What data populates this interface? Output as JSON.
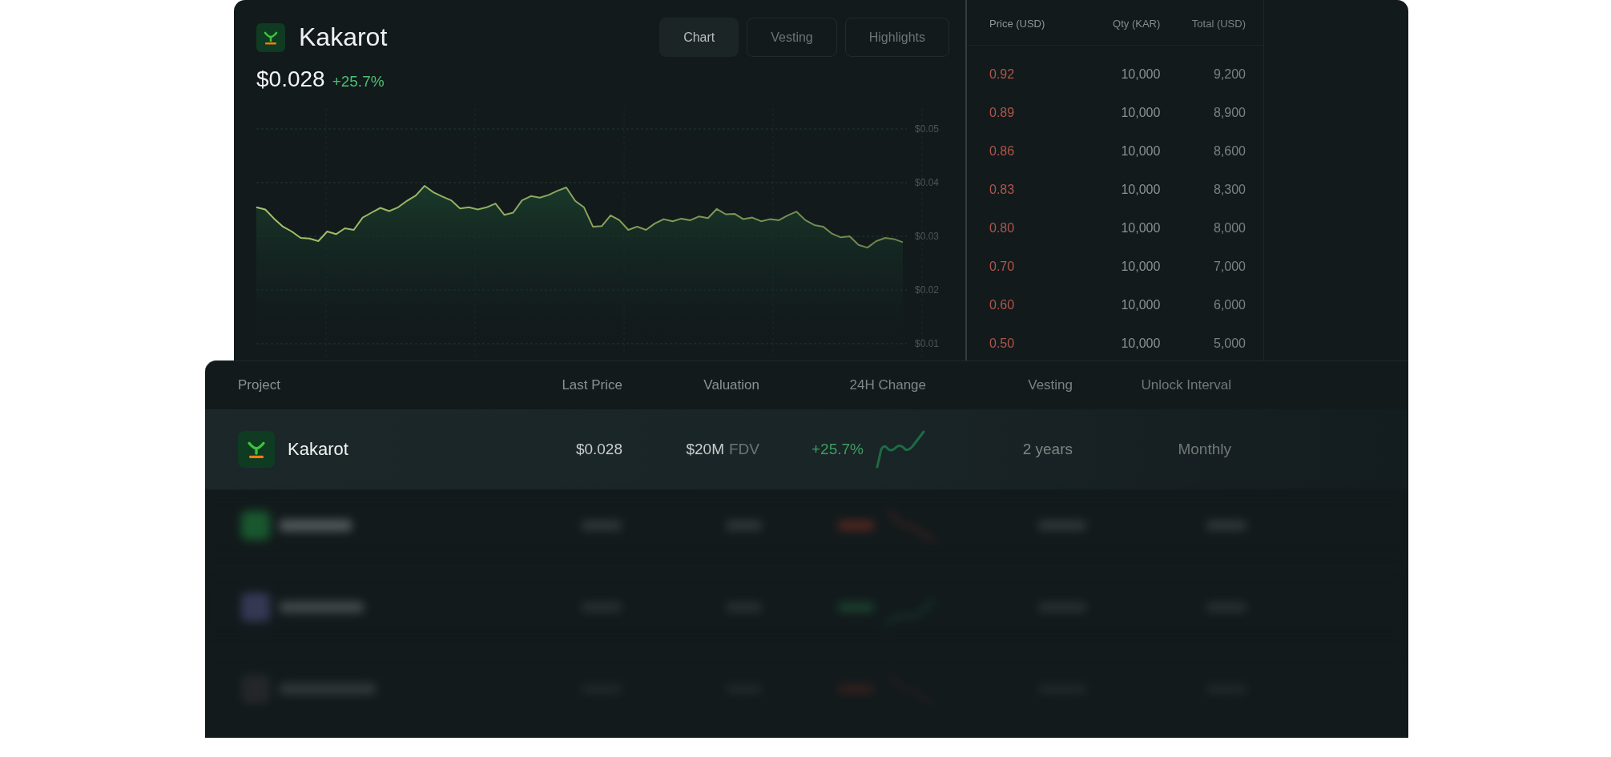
{
  "token": {
    "name": "Kakarot",
    "price": "$0.028",
    "change": "+25.7%"
  },
  "tabs": [
    {
      "label": "Chart",
      "selected": true
    },
    {
      "label": "Vesting",
      "selected": false
    },
    {
      "label": "Highlights",
      "selected": false
    }
  ],
  "chart_data": {
    "type": "area",
    "grid": true,
    "ylim": [
      0.01,
      0.05
    ],
    "yticks": [
      {
        "value": 0.05,
        "label": "$0.05"
      },
      {
        "value": 0.04,
        "label": "$0.04"
      },
      {
        "value": 0.03,
        "label": "$0.03"
      },
      {
        "value": 0.02,
        "label": "$0.02"
      },
      {
        "value": 0.01,
        "label": "$0.01"
      }
    ],
    "series": [
      {
        "color": "#a6c46a",
        "values": [
          0.0354,
          0.035,
          0.0333,
          0.0318,
          0.0309,
          0.0297,
          0.0296,
          0.0291,
          0.0309,
          0.0304,
          0.0315,
          0.0312,
          0.0335,
          0.0344,
          0.0353,
          0.0347,
          0.0354,
          0.0366,
          0.0376,
          0.0394,
          0.0382,
          0.0374,
          0.0367,
          0.0352,
          0.0354,
          0.035,
          0.0354,
          0.0361,
          0.034,
          0.0344,
          0.0367,
          0.0375,
          0.0372,
          0.0377,
          0.0385,
          0.0391,
          0.0366,
          0.0354,
          0.0318,
          0.0319,
          0.0339,
          0.033,
          0.0312,
          0.0318,
          0.0312,
          0.0324,
          0.0332,
          0.0328,
          0.0333,
          0.033,
          0.0337,
          0.0334,
          0.0351,
          0.0341,
          0.0342,
          0.0332,
          0.0335,
          0.0328,
          0.0332,
          0.033,
          0.0339,
          0.0346,
          0.033,
          0.0321,
          0.0318,
          0.0305,
          0.0298,
          0.03,
          0.0284,
          0.0279,
          0.0291,
          0.0297,
          0.0295,
          0.0289
        ]
      }
    ]
  },
  "order_book": {
    "columns": [
      "Price (USD)",
      "Qty (KAR)",
      "Total (USD)"
    ],
    "rows": [
      [
        "0.92",
        "10,000",
        "9,200"
      ],
      [
        "0.89",
        "10,000",
        "8,900"
      ],
      [
        "0.86",
        "10,000",
        "8,600"
      ],
      [
        "0.83",
        "10,000",
        "8,300"
      ],
      [
        "0.80",
        "10,000",
        "8,000"
      ],
      [
        "0.70",
        "10,000",
        "7,000"
      ],
      [
        "0.60",
        "10,000",
        "6,000"
      ],
      [
        "0.50",
        "10,000",
        "5,000"
      ]
    ]
  },
  "table": {
    "columns": [
      "Project",
      "Last Price",
      "Valuation",
      "24H Change",
      "Vesting",
      "Unlock Interval"
    ],
    "rows": [
      {
        "name": "Kakarot",
        "last_price": "$0.028",
        "valuation": "$20M",
        "valuation_unit": "FDV",
        "change": "+25.7%",
        "vesting": "2 years",
        "unlock_interval": "Monthly",
        "selected": true
      }
    ]
  }
}
